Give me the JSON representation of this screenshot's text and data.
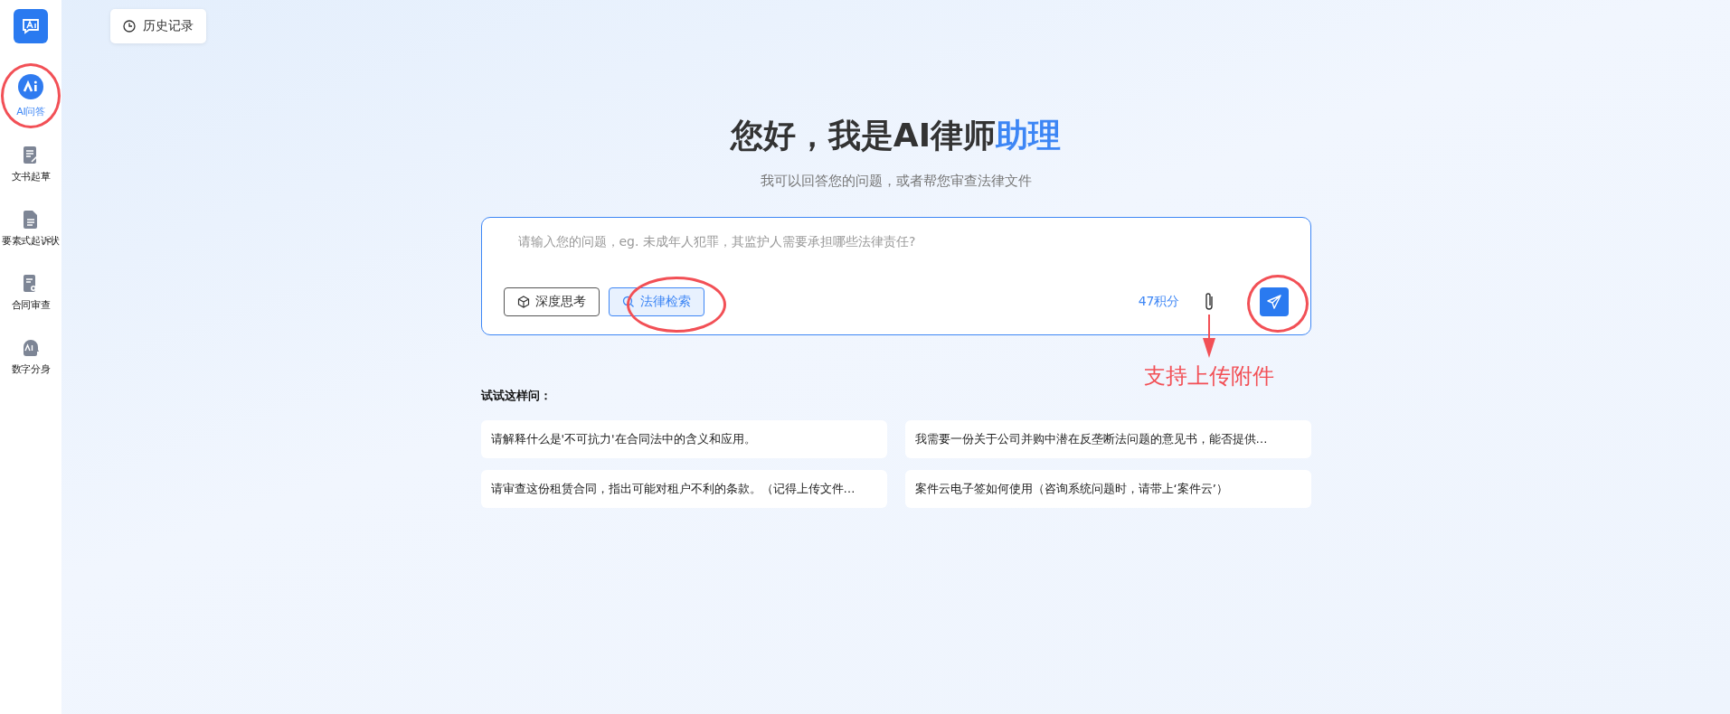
{
  "sidebar": {
    "items": [
      {
        "kind": "ai",
        "label": "AI问答",
        "selected": true,
        "highlighted": true
      },
      {
        "kind": "draft",
        "label": "文书起草",
        "selected": false,
        "highlighted": false
      },
      {
        "kind": "doc",
        "label": "要素式起诉状",
        "selected": false,
        "highlighted": false
      },
      {
        "kind": "review",
        "label": "合同审查",
        "selected": false,
        "highlighted": false
      },
      {
        "kind": "avatar",
        "label": "数字分身",
        "selected": false,
        "highlighted": false
      }
    ]
  },
  "history_button": {
    "label": "历史记录"
  },
  "hero": {
    "title": [
      {
        "text": "您好，我是AI律师",
        "accent": false
      },
      {
        "text": "助理",
        "accent": true
      }
    ],
    "subtitle": "我可以回答您的问题，或者帮您审查法律文件"
  },
  "composer": {
    "placeholder": "请输入您的问题，eg. 未成年人犯罪，其监护人需要承担哪些法律责任?",
    "tools": [
      {
        "kind": "think",
        "label": "深度思考",
        "selected": false,
        "highlighted": false
      },
      {
        "kind": "search",
        "label": "法律检索",
        "selected": true,
        "highlighted": true
      }
    ],
    "credits": "47积分",
    "send_highlighted": true,
    "attach_callout": "支持上传附件"
  },
  "suggestions": {
    "heading": "试试这样问：",
    "items": [
      "请解释什么是'不可抗力'在合同法中的含义和应用。",
      "我需要一份关于公司并购中潜在反垄断法问题的意见书，能否提供…",
      "请审查这份租赁合同，指出可能对租户不利的条款。（记得上传文件…",
      "案件云电子签如何使用（咨询系统问题时，请带上‘案件云’）"
    ]
  }
}
